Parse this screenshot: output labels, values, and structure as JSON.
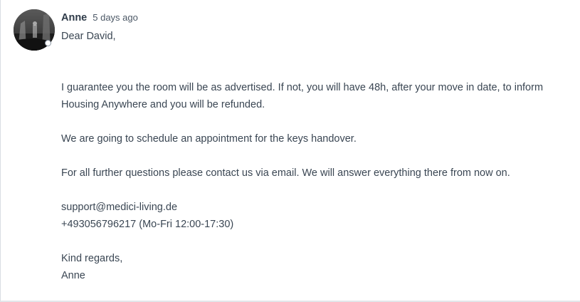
{
  "message": {
    "author": "Anne",
    "timestamp": "5 days ago",
    "avatar_icon": "user-photo-icon",
    "lines": [
      "Dear David,",
      "",
      "",
      "I guarantee you the room will be as advertised. If not, you will have 48h, after your move in date, to inform Housing Anywhere and you will be refunded.",
      "",
      "We are going to schedule an appointment for the keys handover.",
      "",
      "For all further questions please contact us via email. We will answer everything there from now on.",
      "",
      "support@medici-living.de",
      "+493056796217 (Mo-Fri 12:00-17:30)",
      "",
      "Kind regards,",
      "Anne"
    ]
  },
  "colors": {
    "text": "#3a4653",
    "author": "#2f3b49",
    "status_ring": "#8b96a3"
  }
}
